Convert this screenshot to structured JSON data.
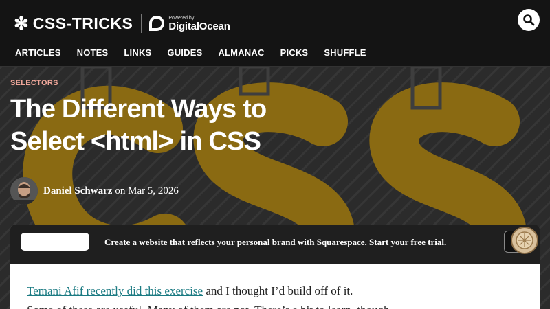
{
  "header": {
    "logo_star": "✻",
    "logo_text": "CSS-TRICKS",
    "powered_by": "Powered by",
    "sponsor_name": "DigitalOcean",
    "search_icon": "search-icon"
  },
  "nav": {
    "items": [
      "ARTICLES",
      "NOTES",
      "LINKS",
      "GUIDES",
      "ALMANAC",
      "PICKS",
      "SHUFFLE"
    ]
  },
  "article": {
    "category": "SELECTORS",
    "title_line1": "The Different Ways to",
    "title_line2": "Select <html> in CSS",
    "author": "Daniel Schwarz",
    "date_text": "on Mar 5, 2026",
    "intro_link": "Temani Afif recently did this exercise",
    "intro_rest": " and I thought I’d build off of it.",
    "second_line": "Some of these are useful. Many of them are not. There’s a bit to learn, though."
  },
  "ad": {
    "text": "Create a website that reflects your personal brand with Squarespace. Start your free trial."
  },
  "colors": {
    "header_bg": "#141414",
    "eyebrow": "#f0a79a",
    "hero_letters": "#8a6a12",
    "link": "#1a7a82"
  }
}
